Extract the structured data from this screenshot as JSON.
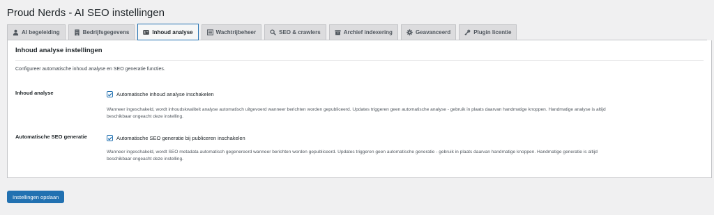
{
  "page": {
    "title": "Proud Nerds - AI SEO instellingen"
  },
  "tabs": [
    {
      "label": "AI begeleiding",
      "icon": "user-icon"
    },
    {
      "label": "Bedrijfsgegevens",
      "icon": "building-icon"
    },
    {
      "label": "Inhoud analyse",
      "icon": "id-card-icon",
      "active": true
    },
    {
      "label": "Wachtrijbeheer",
      "icon": "list-icon"
    },
    {
      "label": "SEO & crawlers",
      "icon": "search-icon"
    },
    {
      "label": "Archief indexering",
      "icon": "archive-icon"
    },
    {
      "label": "Geavanceerd",
      "icon": "gear-icon"
    },
    {
      "label": "Plugin licentie",
      "icon": "key-icon"
    }
  ],
  "panel": {
    "title": "Inhoud analyse instellingen",
    "description": "Configureer automatische inhoud analyse en SEO generatie functies.",
    "settings": [
      {
        "label": "Inhoud analyse",
        "checkbox_label": "Automatische inhoud analyse inschakelen",
        "checked": true,
        "help_line1": "Wanneer ingeschakeld, wordt inhoudskwaliteit analyse automatisch uitgevoerd wanneer berichten worden gepubliceerd. Updates triggeren geen automatische analyse - gebruik in plaats daarvan handmatige knoppen. Handmatige analyse is altijd",
        "help_line2": "beschikbaar ongeacht deze instelling."
      },
      {
        "label": "Automatische SEO generatie",
        "checkbox_label": "Automatische SEO generatie bij publiceren inschakelen",
        "checked": true,
        "help_line1": "Wanneer ingeschakeld, wordt SEO metadata automatisch gegenereerd wanneer berichten worden gepubliceerd. Updates triggeren geen automatische generatie - gebruik in plaats daarvan handmatige knoppen. Handmatige generatie is altijd",
        "help_line2": "beschikbaar ongeacht deze instelling."
      }
    ]
  },
  "actions": {
    "save_label": "Instellingen opslaan"
  },
  "colors": {
    "accent": "#2271b1",
    "background": "#f0f0f1",
    "panel": "#ffffff",
    "tab_inactive": "#dcdcde"
  }
}
